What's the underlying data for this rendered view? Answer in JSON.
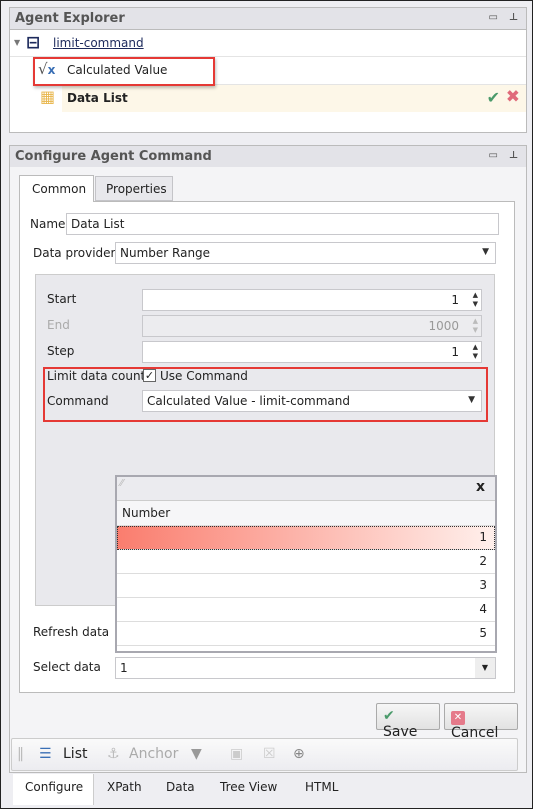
{
  "agent_explorer": {
    "title": "Agent Explorer",
    "tree": [
      {
        "label": "limit-command",
        "icon": "agent-icon"
      },
      {
        "label": "Calculated Value",
        "icon": "square-root-icon"
      },
      {
        "label": "Data List",
        "icon": "data-list-icon"
      }
    ]
  },
  "configure": {
    "title": "Configure Agent Command",
    "tabs": [
      "Common",
      "Properties"
    ],
    "name_label": "Name",
    "name_value": "Data List",
    "provider_label": "Data provider",
    "provider_value": "Number Range",
    "start_label": "Start",
    "start_value": "1",
    "end_label": "End",
    "end_value": "1000",
    "step_label": "Step",
    "step_value": "1",
    "limit_label": "Limit data count",
    "use_command_label": "Use Command",
    "use_command_checked": true,
    "command_label": "Command",
    "command_value": "Calculated Value - limit-command",
    "refresh_label": "Refresh data",
    "select_label": "Select data",
    "select_value": "1",
    "popup": {
      "column": "Number",
      "rows": [
        "1",
        "2",
        "3",
        "4",
        "5"
      ],
      "close": "x"
    },
    "save": "Save",
    "cancel": "Cancel"
  },
  "toolbar": {
    "list": "List",
    "anchor": "Anchor"
  },
  "bottom_tabs": [
    "Configure",
    "XPath",
    "Data",
    "Tree View",
    "HTML"
  ],
  "colors": {
    "highlight": "#e53935",
    "selected_row": "#fa8072"
  }
}
